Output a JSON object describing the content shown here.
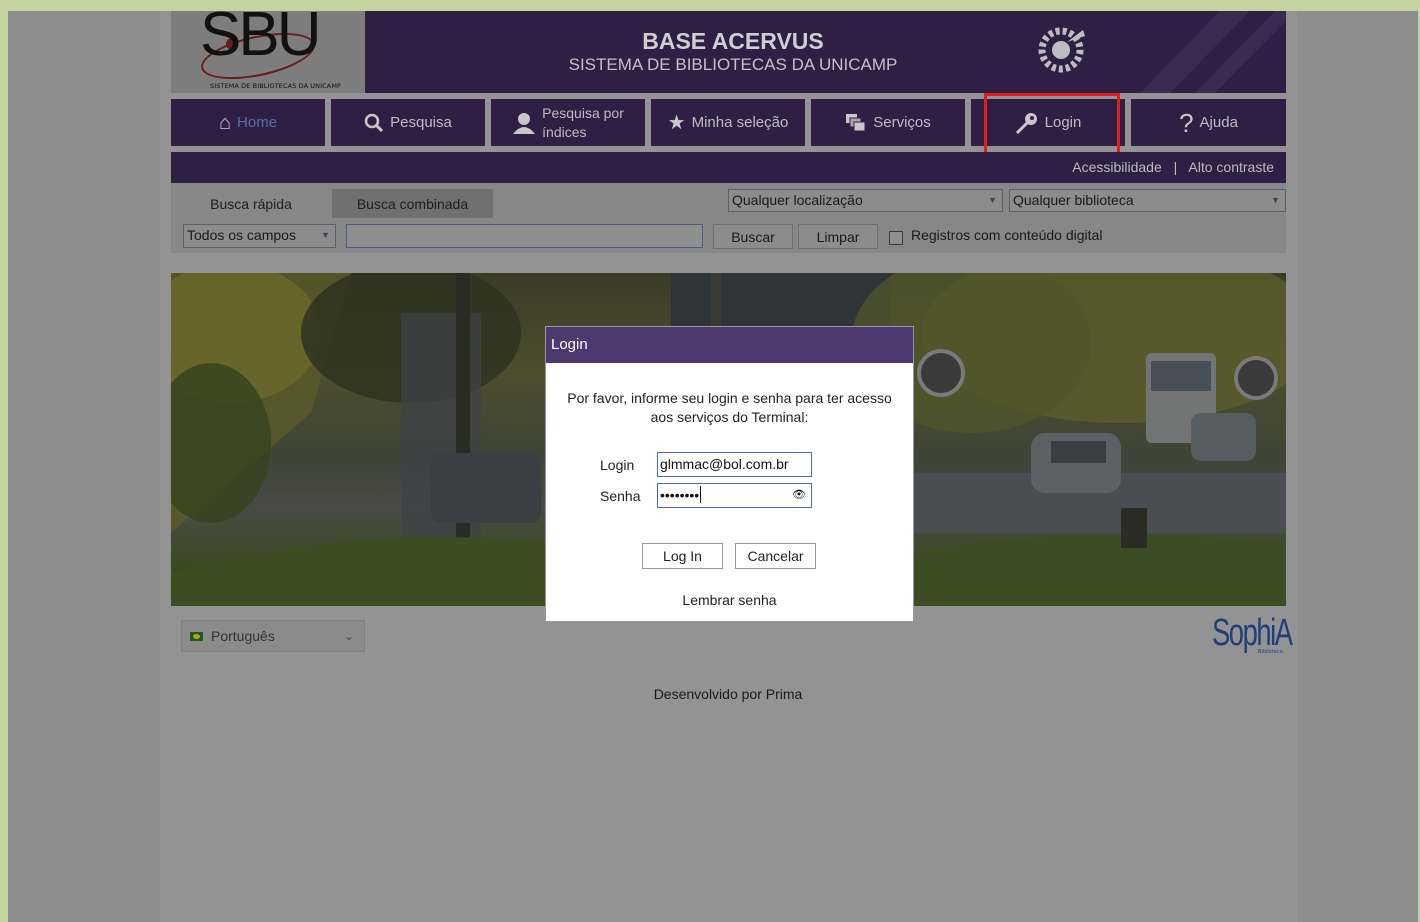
{
  "header": {
    "logo_text": "SBU",
    "logo_subtitle": "SISTEMA DE BIBLIOTECAS DA UNICAMP",
    "title": "BASE ACERVUS",
    "subtitle": "SISTEMA DE BIBLIOTECAS DA UNICAMP"
  },
  "nav": {
    "home": "Home",
    "pesquisa": "Pesquisa",
    "indices_line1": "Pesquisa por",
    "indices_line2": "índices",
    "selecao": "Minha seleção",
    "servicos": "Serviços",
    "login": "Login",
    "ajuda": "Ajuda"
  },
  "accessibility": {
    "acessibilidade": "Acessibilidade",
    "separator": "|",
    "alto_contraste": "Alto contraste"
  },
  "search": {
    "tab_rapida": "Busca rápida",
    "tab_combinada": "Busca combinada",
    "localizacao": "Qualquer localização",
    "biblioteca": "Qualquer biblioteca",
    "campos": "Todos os campos",
    "query": "",
    "buscar": "Buscar",
    "limpar": "Limpar",
    "digital_label": "Registros com conteúdo digital"
  },
  "footer": {
    "language": "Português",
    "brand": "SophiA",
    "brand_sub": "Biblioteca",
    "developed_by": "Desenvolvido por Prima"
  },
  "dialog": {
    "title": "Login",
    "message": "Por favor, informe seu login e senha para ter acesso aos serviços do Terminal:",
    "login_label": "Login",
    "login_value": "glmmac@bol.com.br",
    "senha_label": "Senha",
    "senha_value": "••••••••",
    "login_button": "Log In",
    "cancel_button": "Cancelar",
    "remember": "Lembrar senha"
  },
  "colors": {
    "header_bg": "#2f1f44",
    "dialog_title_bg": "#4e3870",
    "highlight": "#e21b1b",
    "page_bg": "#c5d49f"
  }
}
